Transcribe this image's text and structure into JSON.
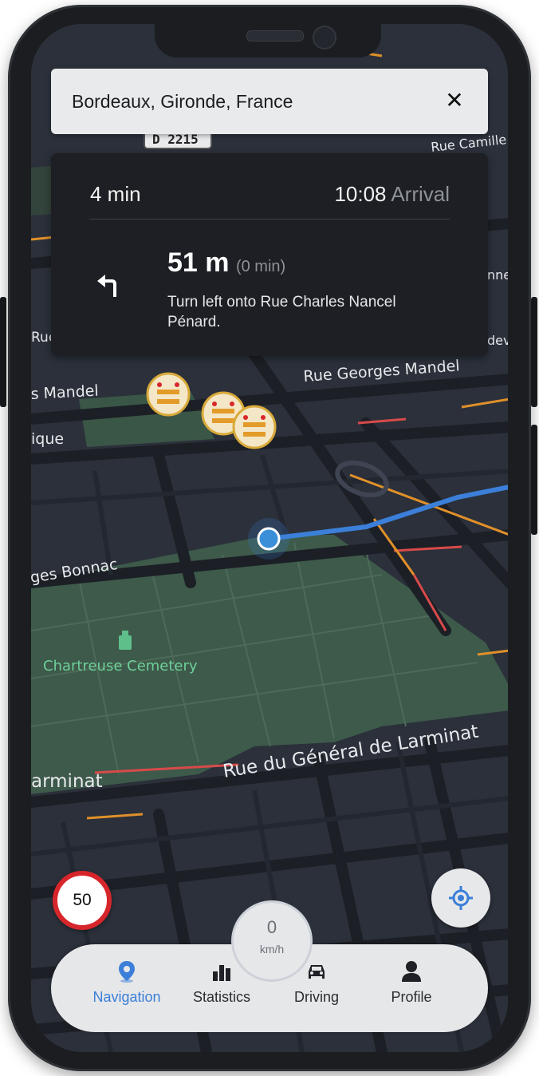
{
  "search": {
    "text": "Bordeaux, Gironde, France"
  },
  "route": {
    "eta": "4 min",
    "arrival_time": "10:08",
    "arrival_label": "Arrival",
    "next_distance": "51 m",
    "next_duration": "(0 min)",
    "instruction": "Turn left onto Rue Charles Nancel Pénard."
  },
  "map_labels": {
    "road_shield": "D 2215",
    "rue_camille": "Rue Camille",
    "rue_georges_mandel": "Rue Georges Mandel",
    "mandel_left": "s Mandel",
    "ique": "ique",
    "bonnac": "ges Bonnac",
    "cemetery": "Chartreuse Cemetery",
    "general_de_larminat": "Rue du Général de Larminat",
    "larminat_left": "arminat",
    "rue_left": "Rue",
    "nne": "nne",
    "dev": "dev"
  },
  "speed_limit": "50",
  "speed": {
    "value": "0",
    "unit": "km/h"
  },
  "tabs": [
    {
      "label": "Navigation",
      "icon": "location-pin-icon",
      "active": true
    },
    {
      "label": "Statistics",
      "icon": "bar-chart-icon",
      "active": false
    },
    {
      "label": "Driving",
      "icon": "car-icon",
      "active": false
    },
    {
      "label": "Profile",
      "icon": "person-icon",
      "active": false
    }
  ],
  "colors": {
    "route": "#3b7fd8",
    "active_tab": "#3b7fd8",
    "speed_limit_ring": "#d7262b",
    "park": "#3d5a4a",
    "map_bg": "#2b303a"
  }
}
